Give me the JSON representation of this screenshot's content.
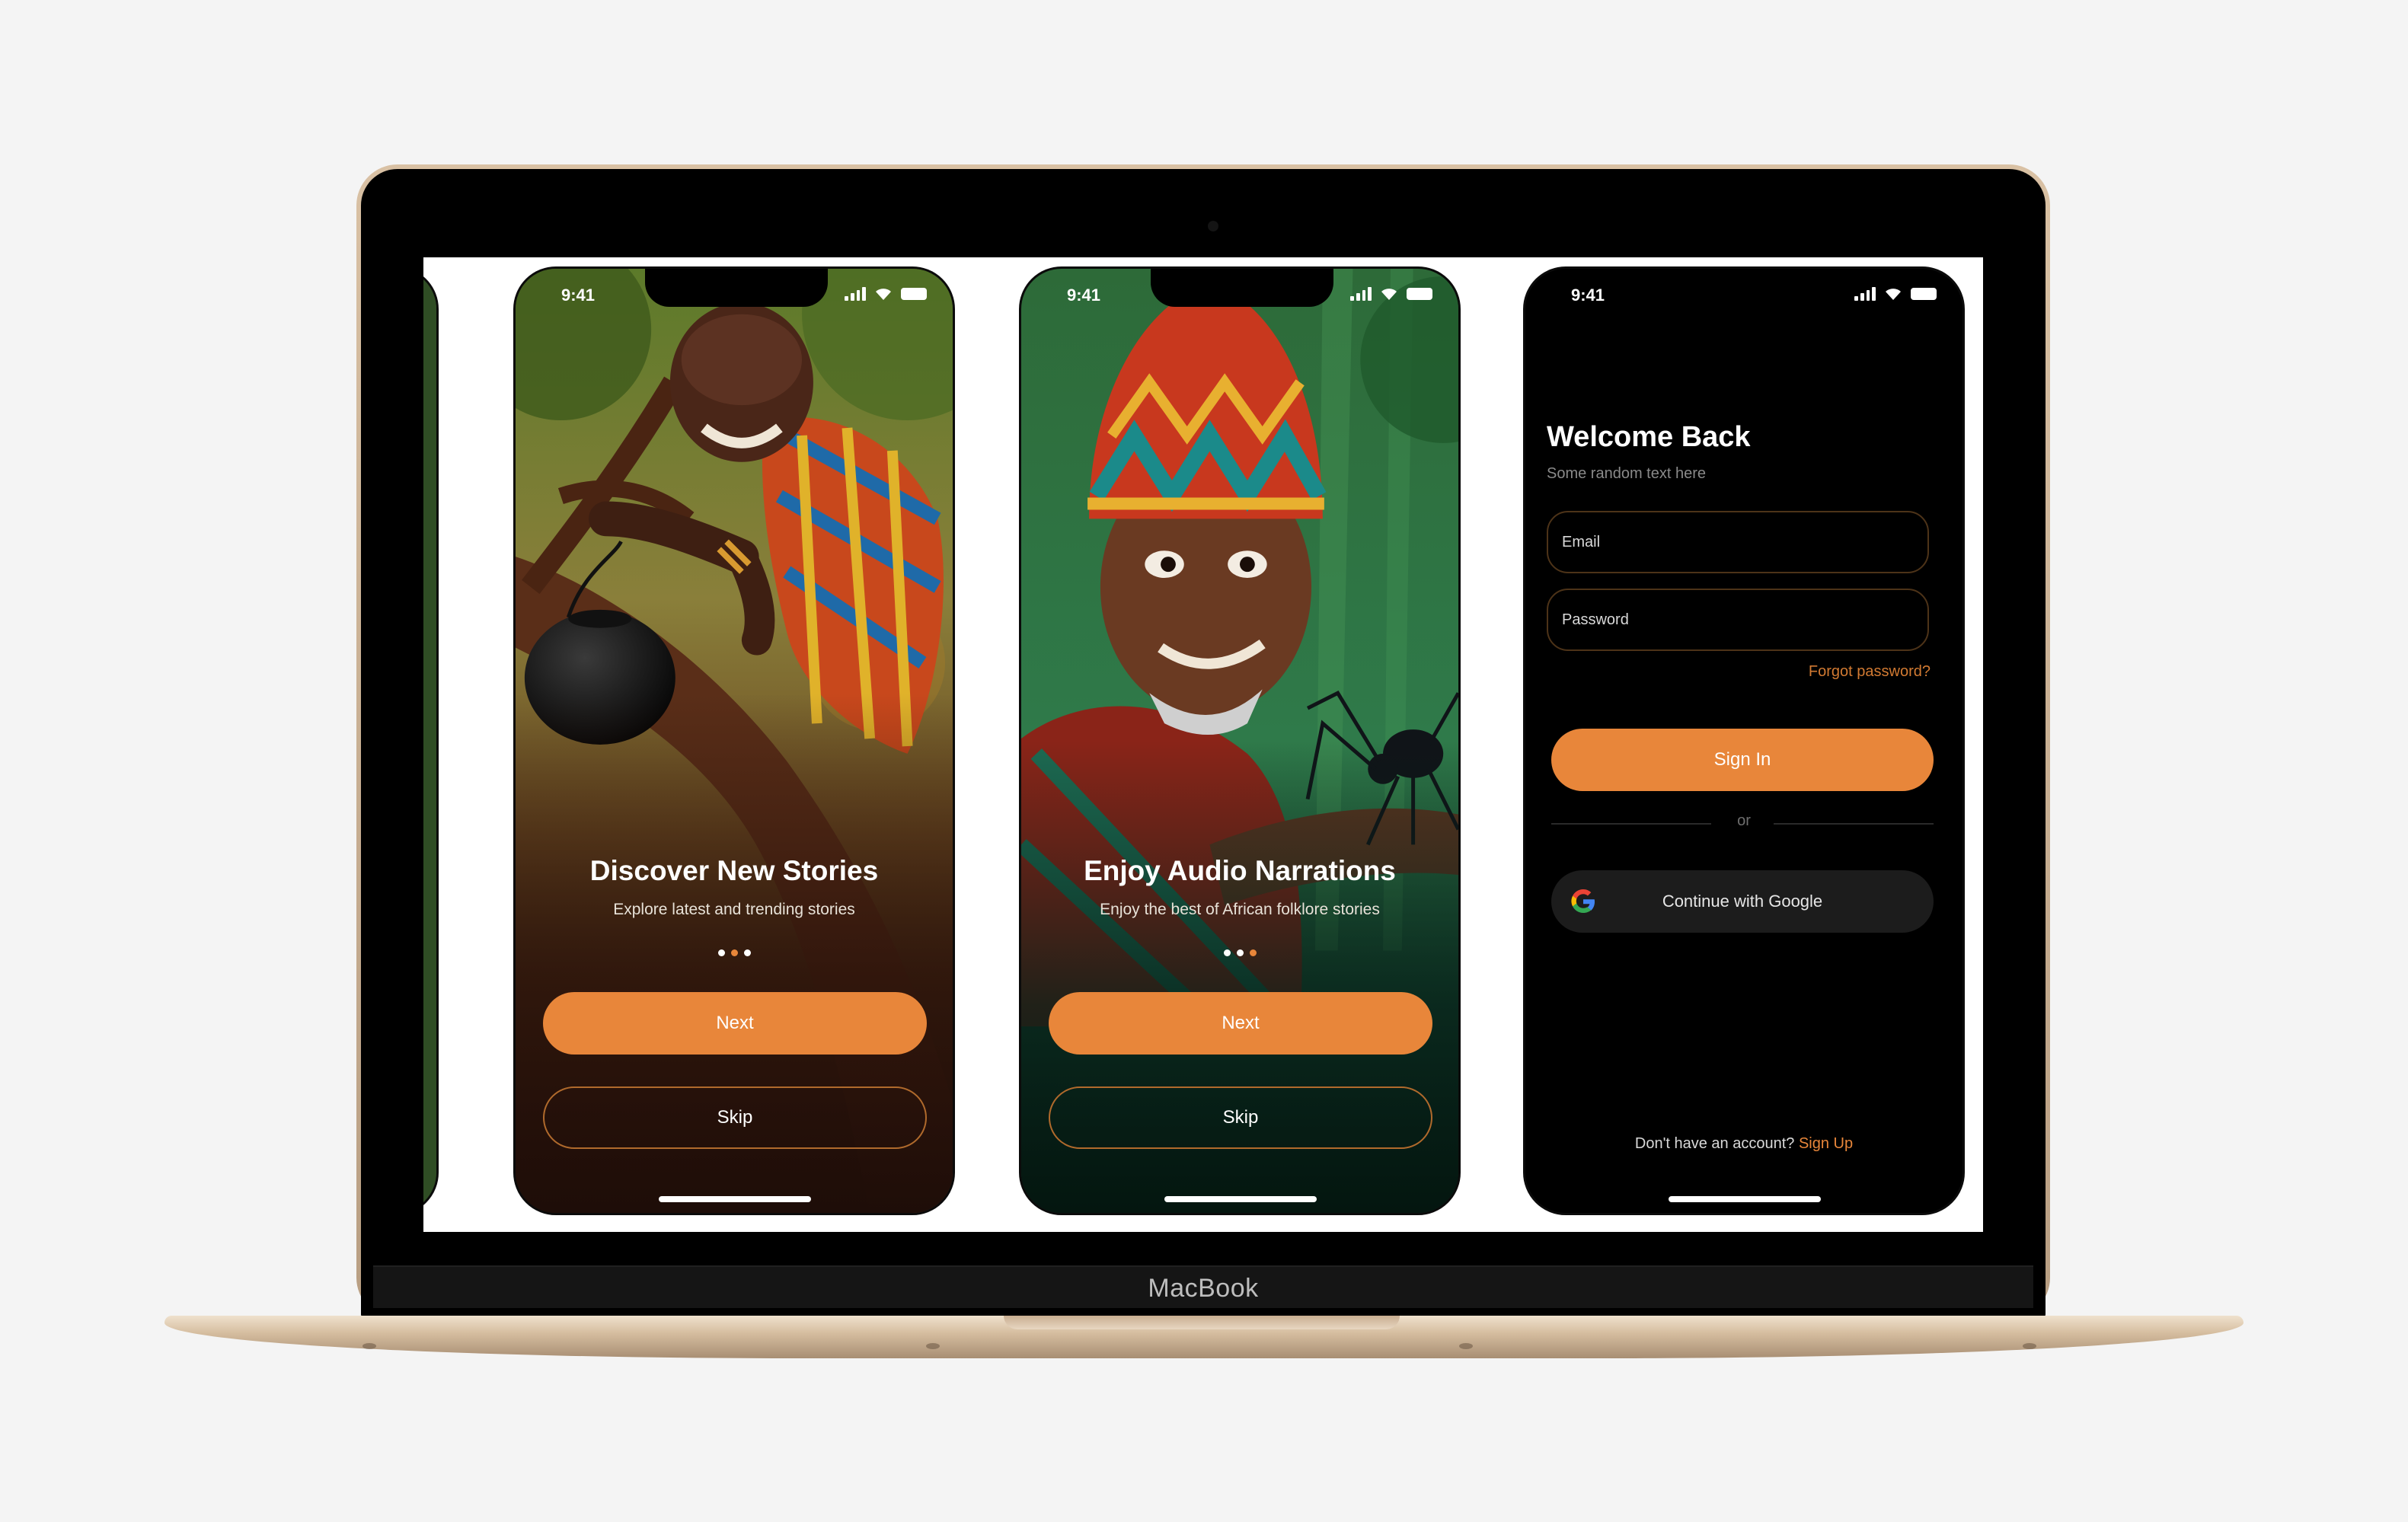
{
  "device": {
    "brand": "MacBook"
  },
  "status_time": "9:41",
  "onboarding": [
    {
      "title": "Discover New Stories",
      "subtitle": "Explore latest and trending stories",
      "active_dot": 1,
      "next_label": "Next",
      "skip_label": "Skip"
    },
    {
      "title": "Enjoy Audio Narrations",
      "subtitle": "Enjoy the best of African folklore stories",
      "active_dot": 2,
      "next_label": "Next",
      "skip_label": "Skip"
    }
  ],
  "signin": {
    "title": "Welcome Back",
    "subtitle": "Some random text here",
    "email_placeholder": "Email",
    "password_placeholder": "Password",
    "forgot_label": "Forgot password?",
    "signin_label": "Sign In",
    "divider_label": "or",
    "google_label": "Continue with Google",
    "no_account_text": "Don't have an account?",
    "signup_label": "Sign Up"
  },
  "colors": {
    "accent": "#e8863a",
    "background": "#000000",
    "page_background": "#f4f4f4"
  }
}
